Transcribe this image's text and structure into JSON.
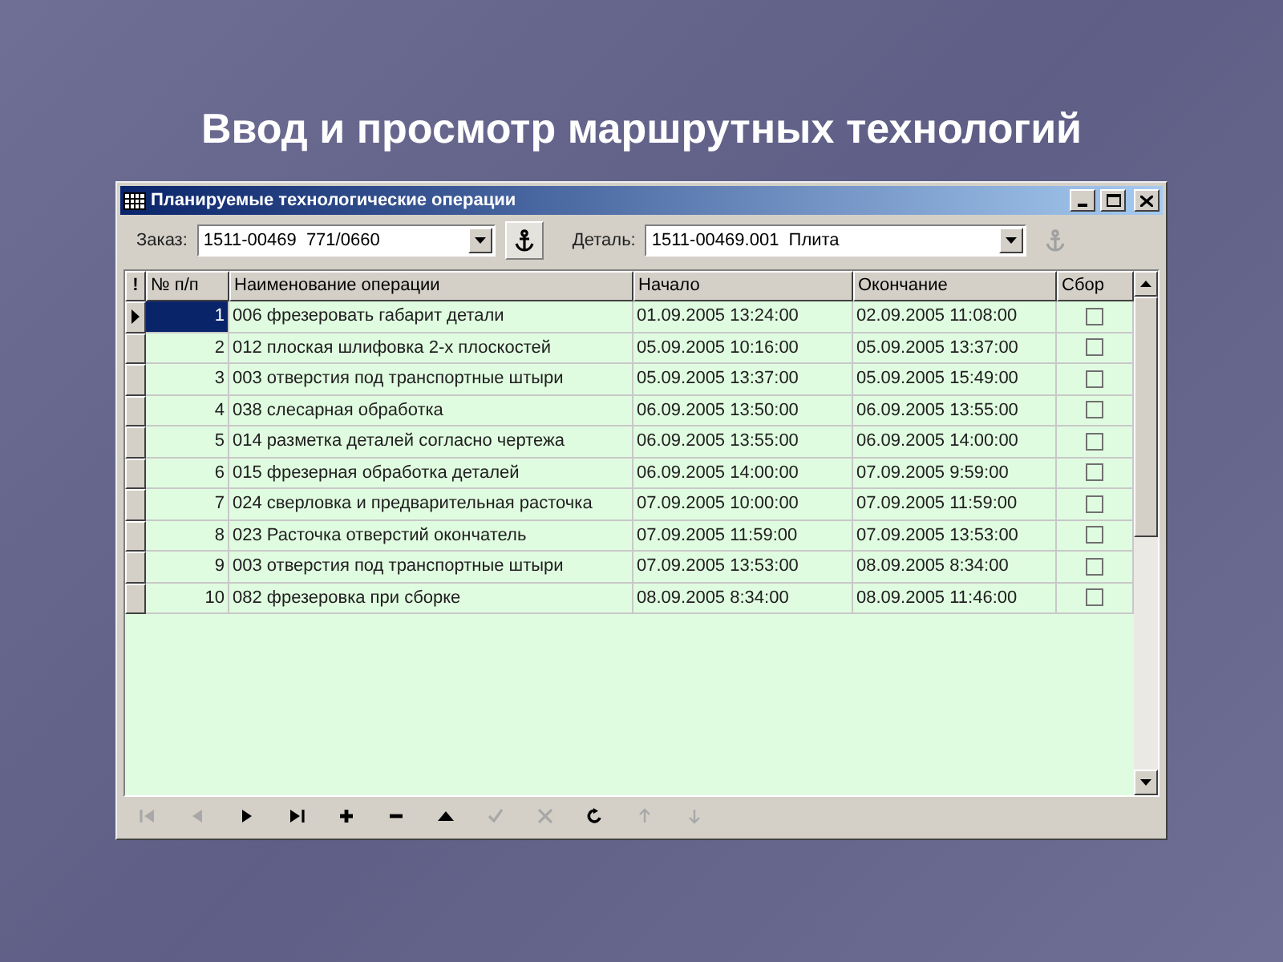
{
  "slide_title": "Ввод и просмотр маршрутных технологий",
  "window": {
    "title": "Планируемые технологические операции"
  },
  "filters": [
    {
      "label": "Заказ:",
      "value": "1511-00469  771/0660",
      "anchor_enabled": true
    },
    {
      "label": "Деталь:",
      "value": "1511-00469.001  Плита",
      "anchor_enabled": false
    }
  ],
  "table": {
    "columns": [
      "!",
      "№ п/п",
      "Наименование операции",
      "Начало",
      "Окончание",
      "Сбор"
    ],
    "rows": [
      {
        "number": "1",
        "operation": "006 фрезеровать габарит детали",
        "start": "01.09.2005 13:24:00",
        "end": "02.09.2005 11:08:00",
        "checked": false,
        "selected": true
      },
      {
        "number": "2",
        "operation": "012 плоская шлифовка 2-х плоскостей",
        "start": "05.09.2005 10:16:00",
        "end": "05.09.2005 13:37:00",
        "checked": false,
        "selected": false
      },
      {
        "number": "3",
        "operation": "003 отверстия под транспортные штыри",
        "start": "05.09.2005 13:37:00",
        "end": "05.09.2005 15:49:00",
        "checked": false,
        "selected": false
      },
      {
        "number": "4",
        "operation": "038 слесарная обработка",
        "start": "06.09.2005 13:50:00",
        "end": "06.09.2005 13:55:00",
        "checked": false,
        "selected": false
      },
      {
        "number": "5",
        "operation": "014 разметка деталей согласно чертежа",
        "start": "06.09.2005 13:55:00",
        "end": "06.09.2005 14:00:00",
        "checked": false,
        "selected": false
      },
      {
        "number": "6",
        "operation": "015 фрезерная обработка деталей",
        "start": "06.09.2005 14:00:00",
        "end": "07.09.2005 9:59:00",
        "checked": false,
        "selected": false
      },
      {
        "number": "7",
        "operation": "024 сверловка и предварительная расточка",
        "start": "07.09.2005 10:00:00",
        "end": "07.09.2005 11:59:00",
        "checked": false,
        "selected": false
      },
      {
        "number": "8",
        "operation": "023 Расточка отверстий окончатель",
        "start": "07.09.2005 11:59:00",
        "end": "07.09.2005 13:53:00",
        "checked": false,
        "selected": false
      },
      {
        "number": "9",
        "operation": "003 отверстия под транспортные штыри",
        "start": "07.09.2005 13:53:00",
        "end": "08.09.2005 8:34:00",
        "checked": false,
        "selected": false
      },
      {
        "number": "10",
        "operation": "082 фрезеровка при сборке",
        "start": "08.09.2005 8:34:00",
        "end": "08.09.2005 11:46:00",
        "checked": false,
        "selected": false
      }
    ]
  },
  "navigator": [
    {
      "kind": "first",
      "enabled": false
    },
    {
      "kind": "prior",
      "enabled": false
    },
    {
      "kind": "next",
      "enabled": true
    },
    {
      "kind": "last",
      "enabled": true
    },
    {
      "kind": "insert",
      "enabled": true
    },
    {
      "kind": "delete",
      "enabled": true
    },
    {
      "kind": "edit",
      "enabled": true
    },
    {
      "kind": "post",
      "enabled": false
    },
    {
      "kind": "cancel",
      "enabled": false
    },
    {
      "kind": "refresh",
      "enabled": true
    },
    {
      "kind": "up",
      "enabled": false
    },
    {
      "kind": "down",
      "enabled": false
    }
  ]
}
